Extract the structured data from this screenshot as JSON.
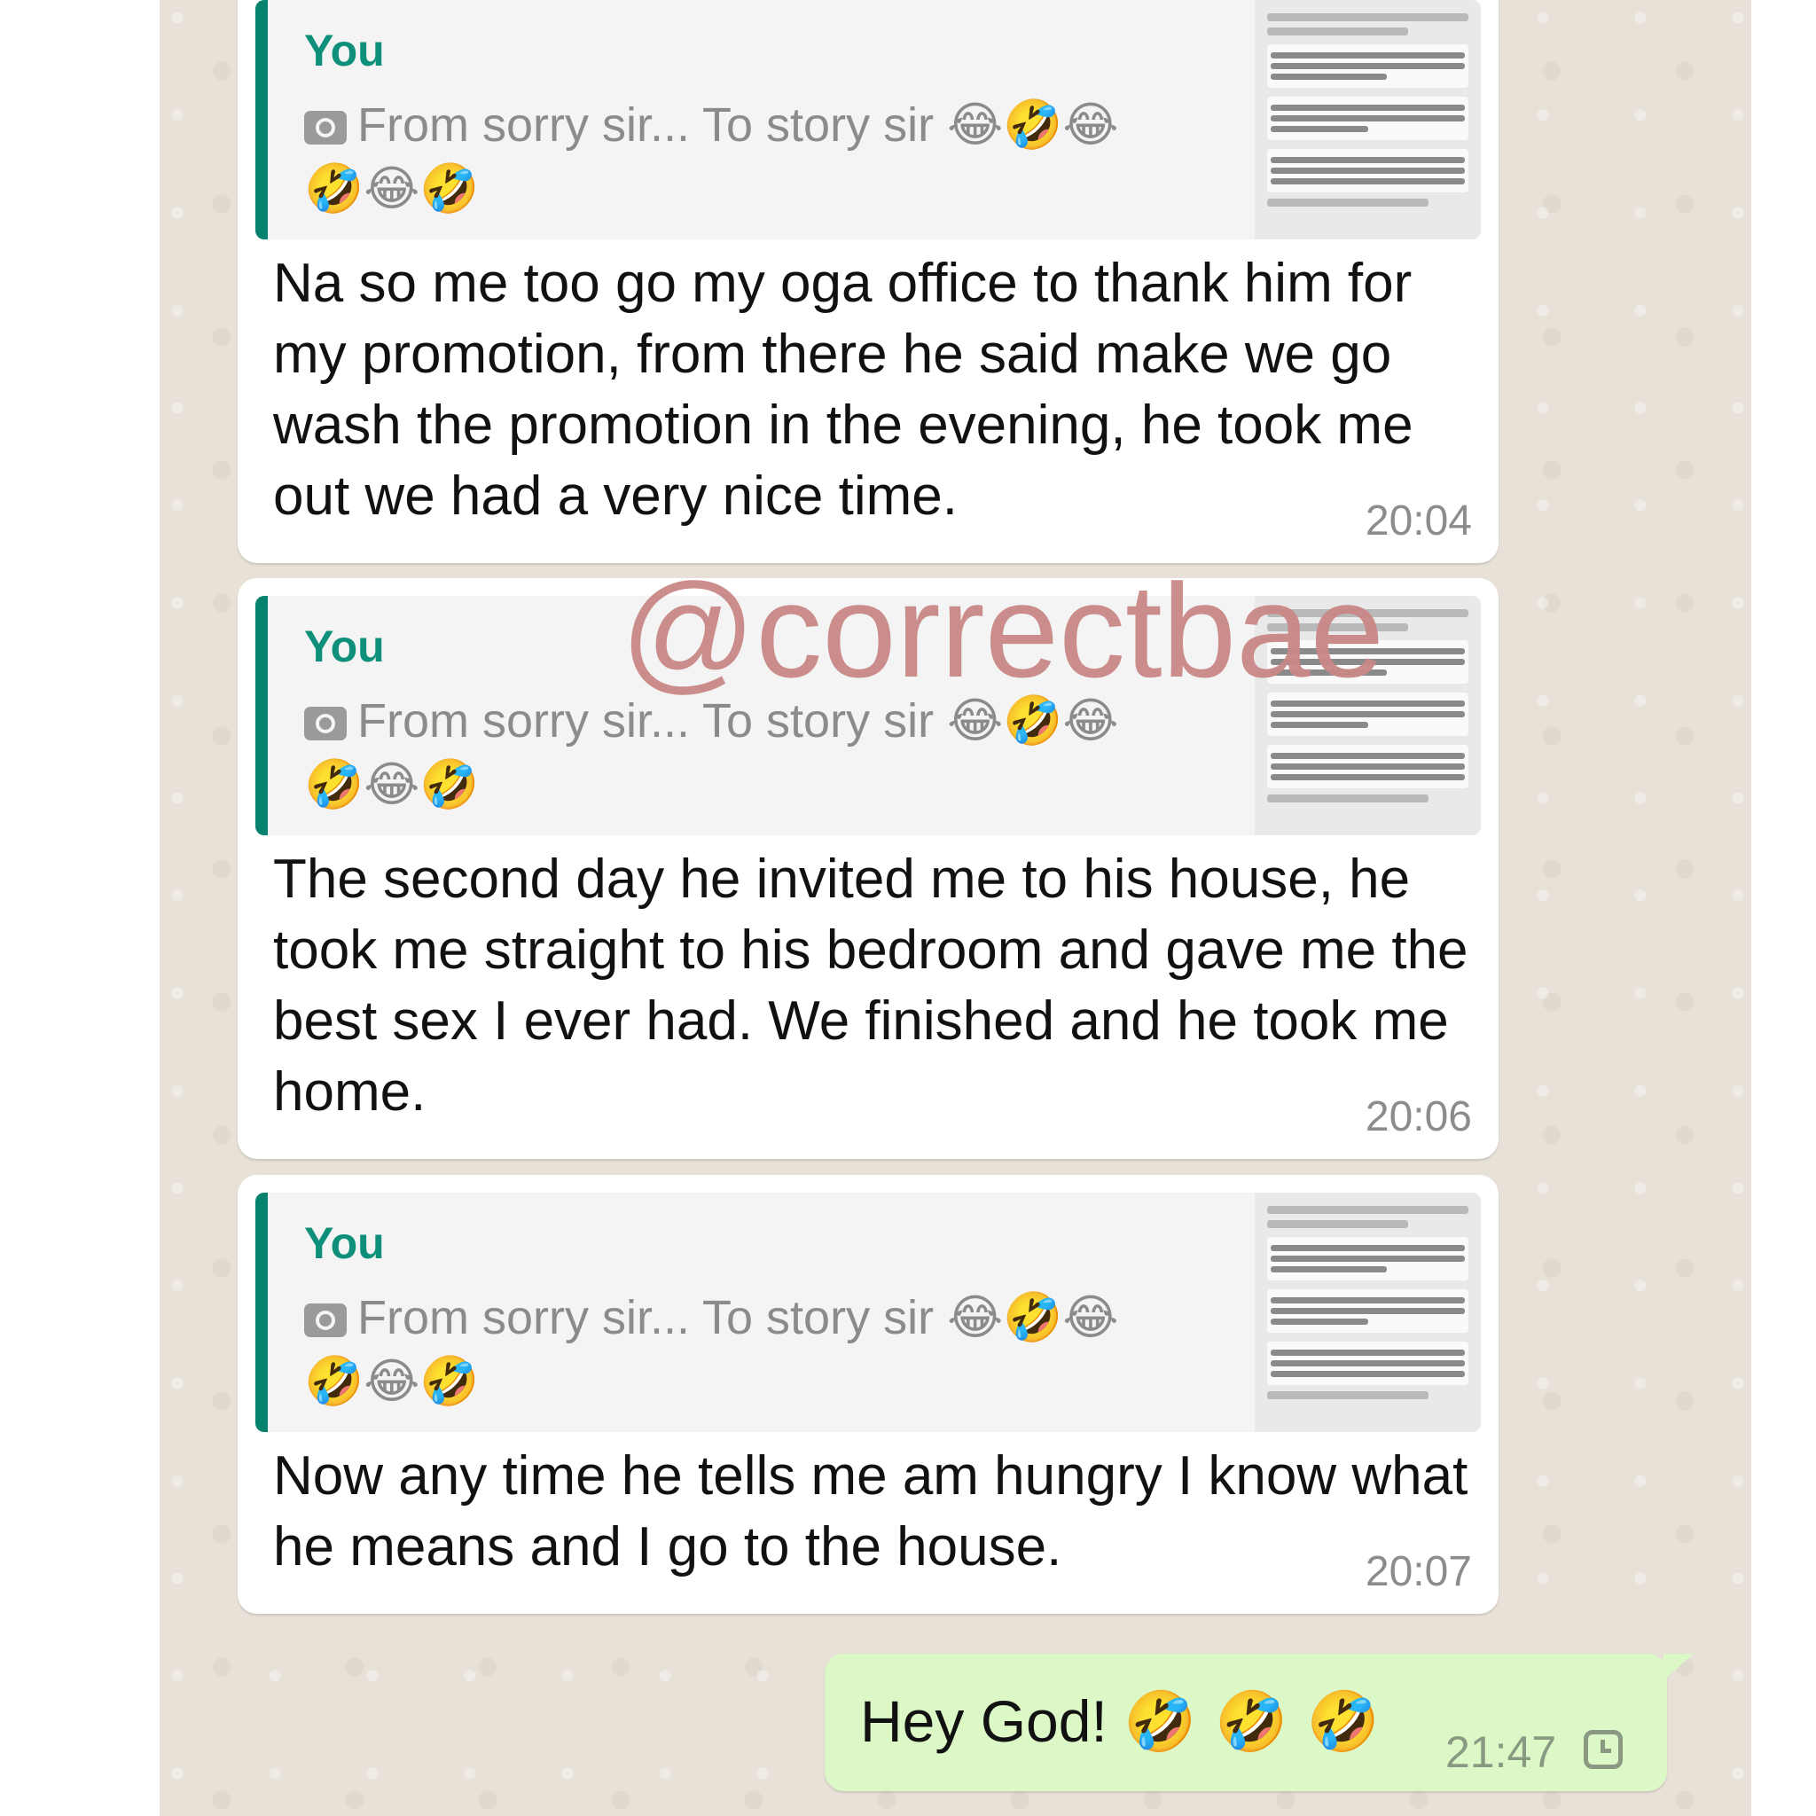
{
  "messages": [
    {
      "quote_author": "You",
      "quote_text": "From sorry sir... To story sir",
      "quote_emojis_line1": "😂🤣😂",
      "quote_emojis_line2": "🤣😂🤣",
      "text": "Na so me too go my oga office  to thank him for my promotion, from there he said make we go wash the promotion in the evening, he took me out we had a very nice time.",
      "time": "20:04"
    },
    {
      "quote_author": "You",
      "quote_text": "From sorry sir... To story sir",
      "quote_emojis_line1": "😂🤣😂",
      "quote_emojis_line2": "🤣😂🤣",
      "text": "The second day he invited me to his house, he took me straight to his bedroom and gave me the best sex I ever had. We finished  and he took me home.",
      "time": "20:06"
    },
    {
      "quote_author": "You",
      "quote_text": "From sorry sir... To story sir",
      "quote_emojis_line1": "😂🤣😂",
      "quote_emojis_line2": "🤣😂🤣",
      "text": "Now any time he tells me am hungry  I know what he means and I go to the house.",
      "time": "20:07"
    }
  ],
  "outgoing": {
    "text": "Hey God!",
    "emojis": "🤣 🤣 🤣",
    "time": "21:47",
    "status_icon": "clock-pending-icon"
  },
  "watermark": "@correctbae",
  "colors": {
    "chat_background": "#e7e1d8",
    "incoming_bubble": "#ffffff",
    "outgoing_bubble": "#dcf8c6",
    "quote_accent": "#06826e",
    "watermark": "#c98887"
  }
}
